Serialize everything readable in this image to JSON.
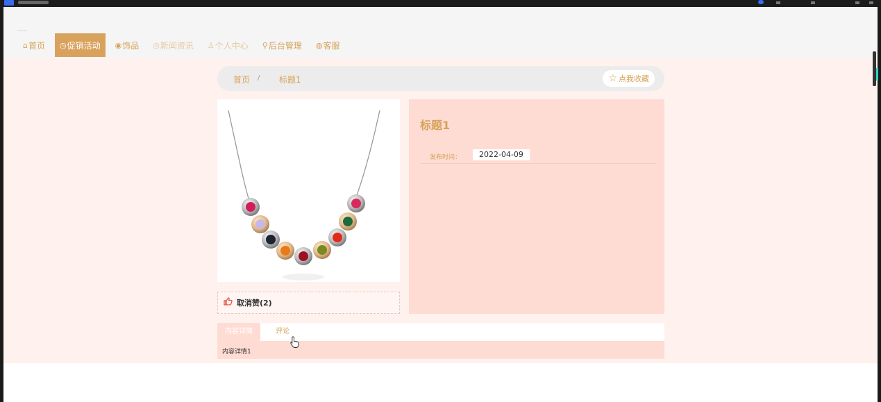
{
  "nav": {
    "items": [
      {
        "label": "首页",
        "icon": "home-icon",
        "glyph": "⌂"
      },
      {
        "label": "促销活动",
        "icon": "clock-icon",
        "glyph": "◷"
      },
      {
        "label": "饰品",
        "icon": "gem-icon",
        "glyph": "◉"
      },
      {
        "label": "新闻资讯",
        "icon": "news-icon",
        "glyph": "◎"
      },
      {
        "label": "个人中心",
        "icon": "user-icon",
        "glyph": "♙"
      },
      {
        "label": "后台管理",
        "icon": "link-icon",
        "glyph": "⚲"
      },
      {
        "label": "客服",
        "icon": "service-icon",
        "glyph": "◍"
      }
    ],
    "active_index": 1
  },
  "breadcrumb": {
    "home": "首页",
    "separator": "/",
    "current": "标题1"
  },
  "favorite": {
    "label": "点我收藏",
    "icon": "star-icon",
    "glyph": "☆"
  },
  "product": {
    "title": "标题1",
    "publish_label": "发布时间：",
    "publish_date": "2022-04-09",
    "image": "necklace-image"
  },
  "like": {
    "label": "取消赞(2)",
    "icon": "thumbs-up-icon"
  },
  "tabs": {
    "items": [
      "内容详情",
      "评论"
    ],
    "active_index": 0
  },
  "detail": {
    "content": "内容详情1"
  },
  "colors": {
    "accent": "#d9a25c",
    "band": "#fff1ed",
    "panel": "#ffdcd3",
    "like": "#e94b3c"
  }
}
